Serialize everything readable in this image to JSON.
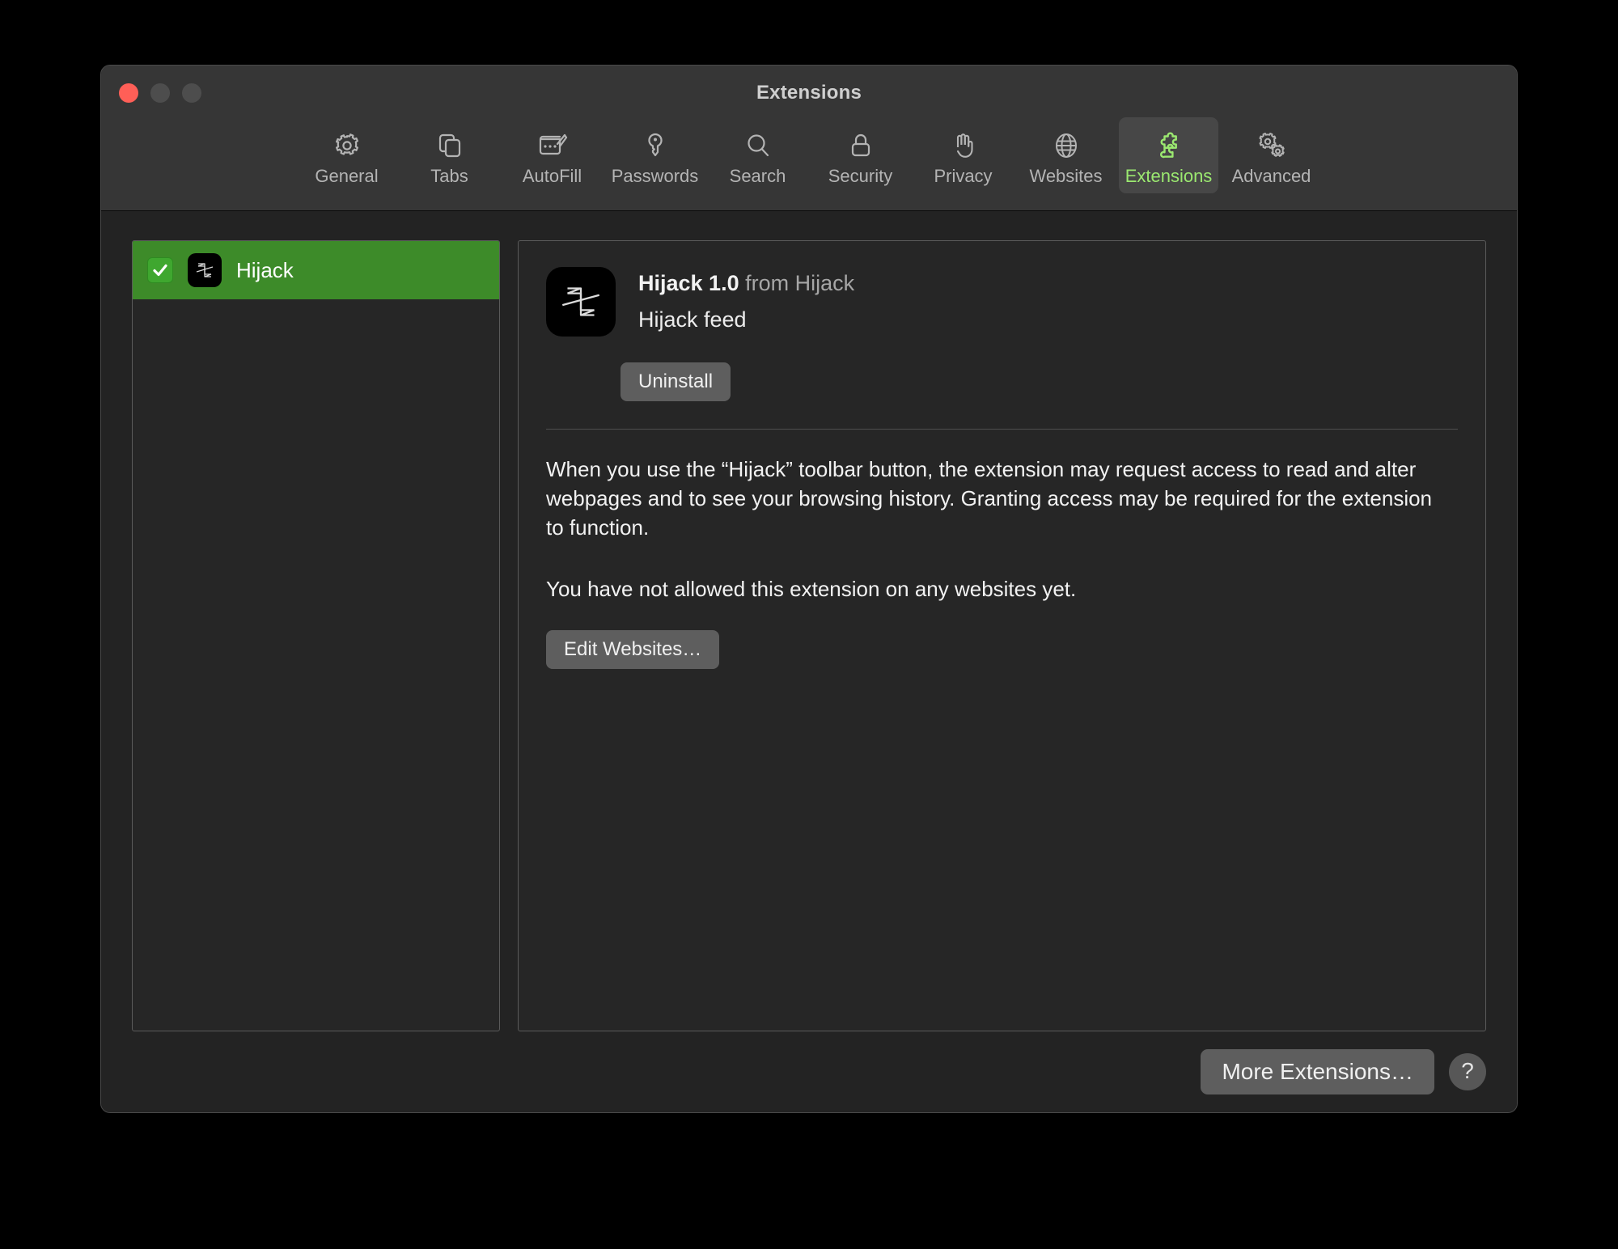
{
  "window": {
    "title": "Extensions",
    "traffic_lights": [
      {
        "name": "close",
        "color": "#ff5f57"
      },
      {
        "name": "minimize",
        "color": "#4d4d4d"
      },
      {
        "name": "zoom",
        "color": "#4d4d4d"
      }
    ]
  },
  "toolbar": {
    "accent_color": "#9be870",
    "selected": "Extensions",
    "items": [
      {
        "label": "General",
        "icon": "gear-icon"
      },
      {
        "label": "Tabs",
        "icon": "tabs-icon"
      },
      {
        "label": "AutoFill",
        "icon": "autofill-icon"
      },
      {
        "label": "Passwords",
        "icon": "key-icon"
      },
      {
        "label": "Search",
        "icon": "search-icon"
      },
      {
        "label": "Security",
        "icon": "lock-icon"
      },
      {
        "label": "Privacy",
        "icon": "hand-icon"
      },
      {
        "label": "Websites",
        "icon": "globe-icon"
      },
      {
        "label": "Extensions",
        "icon": "puzzle-icon"
      },
      {
        "label": "Advanced",
        "icon": "gears-icon"
      }
    ]
  },
  "sidebar": {
    "selected_color": "#3d8b29",
    "extensions": [
      {
        "label": "Hijack",
        "enabled": true,
        "checkbox_color": "#3fa72f",
        "icon": "hijack-app-icon"
      }
    ]
  },
  "detail": {
    "icon": "hijack-app-icon",
    "name": "Hijack 1.0",
    "from": "from Hijack",
    "description": "Hijack feed",
    "uninstall_label": "Uninstall",
    "permission_paragraph": "When you use the “Hijack” toolbar button, the extension may request access to read and alter webpages and to see your browsing history. Granting access may be required for the extension to function.",
    "status_paragraph": "You have not allowed this extension on any websites yet.",
    "edit_websites_label": "Edit Websites…"
  },
  "footer": {
    "more_extensions_label": "More Extensions…",
    "help_label": "?"
  }
}
